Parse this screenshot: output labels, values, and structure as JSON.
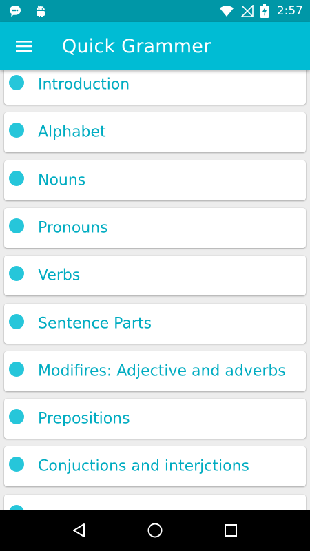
{
  "status_bar": {
    "time": "2:57",
    "icons": [
      "chat-notification-icon",
      "android-icon",
      "wifi-icon",
      "no-signal-icon",
      "battery-charging-icon"
    ]
  },
  "app_bar": {
    "title": "Quick Grammer",
    "menu_icon": "hamburger-menu-icon"
  },
  "topics": [
    {
      "label": "Introduction"
    },
    {
      "label": "Alphabet"
    },
    {
      "label": "Nouns"
    },
    {
      "label": "Pronouns"
    },
    {
      "label": "Verbs"
    },
    {
      "label": "Sentence Parts"
    },
    {
      "label": "Modifires: Adjective and adverbs"
    },
    {
      "label": "Prepositions"
    },
    {
      "label": "Conjuctions and interjctions"
    },
    {
      "label": ""
    }
  ],
  "nav_bar": {
    "buttons": [
      "back-icon",
      "home-icon",
      "recents-icon"
    ]
  },
  "colors": {
    "status_bar": "#0097a7",
    "app_bar": "#00bcd4",
    "accent_dot": "#26c6da",
    "item_text": "#00acc1",
    "list_background": "#ededed"
  }
}
